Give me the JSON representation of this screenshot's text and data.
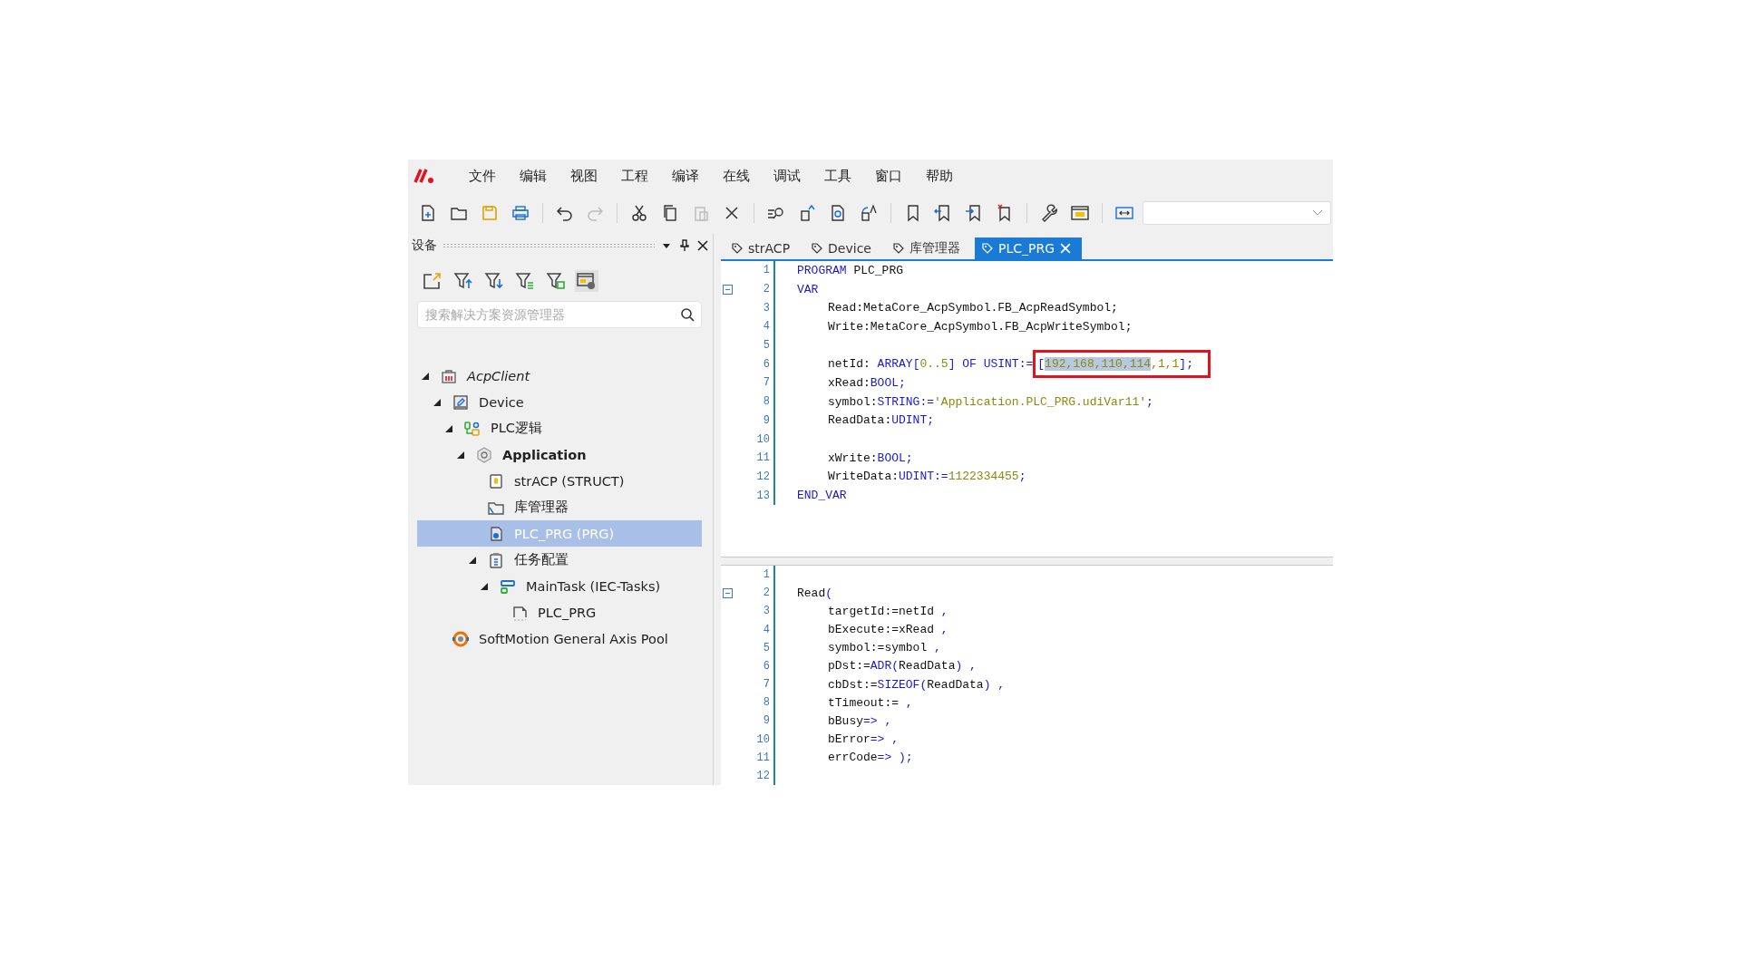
{
  "menu": [
    "文件",
    "编辑",
    "视图",
    "工程",
    "编译",
    "在线",
    "调试",
    "工具",
    "窗口",
    "帮助"
  ],
  "device_panel": {
    "title": "设备",
    "search": {
      "placeholder": "搜索解决方案资源管理器"
    },
    "tree": [
      {
        "label": "AcpClient",
        "kind": "project",
        "expanded": true,
        "selected": false,
        "children": [
          {
            "label": "Device",
            "kind": "device",
            "expanded": true,
            "selected": false,
            "children": [
              {
                "label": "PLC逻辑",
                "kind": "plc-logic",
                "expanded": true,
                "selected": false,
                "children": [
                  {
                    "label": "Application",
                    "kind": "application",
                    "expanded": true,
                    "selected": false,
                    "children": [
                      {
                        "label": "strACP (STRUCT)",
                        "kind": "struct",
                        "selected": false
                      },
                      {
                        "label": "库管理器",
                        "kind": "folder",
                        "selected": false
                      },
                      {
                        "label": "PLC_PRG (PRG)",
                        "kind": "program",
                        "selected": true
                      },
                      {
                        "label": "任务配置",
                        "kind": "task-config",
                        "expanded": true,
                        "selected": false,
                        "children": [
                          {
                            "label": "MainTask (IEC-Tasks)",
                            "kind": "task",
                            "expanded": true,
                            "selected": false,
                            "children": [
                              {
                                "label": "PLC_PRG",
                                "kind": "program-call",
                                "selected": false
                              }
                            ]
                          }
                        ]
                      }
                    ]
                  }
                ]
              }
            ]
          },
          {
            "label": "SoftMotion General Axis Pool",
            "kind": "axis-pool",
            "selected": false
          }
        ]
      }
    ]
  },
  "tabs": [
    {
      "label": "strACP",
      "selected": false
    },
    {
      "label": "Device",
      "selected": false
    },
    {
      "label": "库管理器",
      "selected": false
    },
    {
      "label": "PLC_PRG",
      "selected": true
    }
  ],
  "declaration": [
    {
      "number": "1",
      "kind": "outer",
      "fold": false,
      "segments": [
        {
          "boxed": false,
          "tokens": [
            {
              "kind": "kw",
              "text": "PROGRAM"
            },
            {
              "kind": "plain",
              "text": " PLC_PRG"
            }
          ]
        }
      ]
    },
    {
      "number": "2",
      "kind": "outer",
      "fold": true,
      "segments": [
        {
          "boxed": false,
          "tokens": [
            {
              "kind": "kw",
              "text": "VAR"
            }
          ]
        }
      ]
    },
    {
      "number": "3",
      "kind": "inner",
      "fold": false,
      "segments": [
        {
          "boxed": false,
          "tokens": [
            {
              "kind": "plain",
              "text": "Read:MetaCore_AcpSymbol.FB_AcpReadSymbol;"
            }
          ]
        }
      ]
    },
    {
      "number": "4",
      "kind": "inner",
      "fold": false,
      "segments": [
        {
          "boxed": false,
          "tokens": [
            {
              "kind": "plain",
              "text": "Write:MetaCore_AcpSymbol.FB_AcpWriteSymbol;"
            }
          ]
        }
      ]
    },
    {
      "number": "5",
      "kind": "inner",
      "fold": false
    },
    {
      "number": "6",
      "kind": "inner",
      "fold": false,
      "segments": [
        {
          "boxed": false,
          "tokens": [
            {
              "kind": "plain",
              "text": "netId: "
            },
            {
              "kind": "kw",
              "text": "ARRAY"
            },
            {
              "kind": "op",
              "text": "["
            },
            {
              "kind": "lit",
              "text": "0..5"
            },
            {
              "kind": "op",
              "text": "] "
            },
            {
              "kind": "kw",
              "text": "OF USINT"
            },
            {
              "kind": "op",
              "text": ":="
            }
          ]
        },
        {
          "boxed": true,
          "tokens": [
            {
              "kind": "op",
              "text": "[",
              "selected": false
            },
            {
              "kind": "lit",
              "text": "192,168,110,114",
              "selected": true
            },
            {
              "kind": "lit",
              "text": ",1,1",
              "selected": false
            },
            {
              "kind": "op",
              "text": "];",
              "selected": false
            }
          ]
        }
      ]
    },
    {
      "number": "7",
      "kind": "inner",
      "fold": false,
      "segments": [
        {
          "boxed": false,
          "tokens": [
            {
              "kind": "plain",
              "text": "xRead:"
            },
            {
              "kind": "kw",
              "text": "BOOL;"
            }
          ]
        }
      ]
    },
    {
      "number": "8",
      "kind": "inner",
      "fold": false,
      "segments": [
        {
          "boxed": false,
          "tokens": [
            {
              "kind": "plain",
              "text": "symbol:"
            },
            {
              "kind": "kw",
              "text": "STRING:="
            },
            {
              "kind": "lit",
              "text": "'Application.PLC_PRG.udiVar11'"
            },
            {
              "kind": "op",
              "text": ";"
            }
          ]
        }
      ]
    },
    {
      "number": "9",
      "kind": "inner",
      "fold": false,
      "segments": [
        {
          "boxed": false,
          "tokens": [
            {
              "kind": "plain",
              "text": "ReadData:"
            },
            {
              "kind": "kw",
              "text": "UDINT;"
            }
          ]
        }
      ]
    },
    {
      "number": "10",
      "kind": "inner",
      "fold": false
    },
    {
      "number": "11",
      "kind": "inner",
      "fold": false,
      "segments": [
        {
          "boxed": false,
          "tokens": [
            {
              "kind": "plain",
              "text": "xWrite:"
            },
            {
              "kind": "kw",
              "text": "BOOL;"
            }
          ]
        }
      ]
    },
    {
      "number": "12",
      "kind": "inner",
      "fold": false,
      "segments": [
        {
          "boxed": false,
          "tokens": [
            {
              "kind": "plain",
              "text": "WriteData:"
            },
            {
              "kind": "kw",
              "text": "UDINT:="
            },
            {
              "kind": "lit",
              "text": "1122334455"
            },
            {
              "kind": "op",
              "text": ";"
            }
          ]
        }
      ]
    },
    {
      "number": "13",
      "kind": "outer",
      "fold": false,
      "segments": [
        {
          "boxed": false,
          "tokens": [
            {
              "kind": "kw",
              "text": "END_VAR"
            }
          ]
        }
      ]
    }
  ],
  "implementation": [
    {
      "number": "1",
      "kind": "outer",
      "fold": false
    },
    {
      "number": "2",
      "kind": "outer",
      "fold": true,
      "segments": [
        {
          "boxed": false,
          "tokens": [
            {
              "kind": "plain",
              "text": "Read"
            },
            {
              "kind": "op",
              "text": "("
            }
          ]
        }
      ]
    },
    {
      "number": "3",
      "kind": "inner",
      "fold": false,
      "segments": [
        {
          "boxed": false,
          "tokens": [
            {
              "kind": "plain",
              "text": "targetId:=netId "
            },
            {
              "kind": "op",
              "text": ","
            }
          ]
        }
      ]
    },
    {
      "number": "4",
      "kind": "inner",
      "fold": false,
      "segments": [
        {
          "boxed": false,
          "tokens": [
            {
              "kind": "plain",
              "text": "bExecute:=xRead "
            },
            {
              "kind": "op",
              "text": ","
            }
          ]
        }
      ]
    },
    {
      "number": "5",
      "kind": "inner",
      "fold": false,
      "segments": [
        {
          "boxed": false,
          "tokens": [
            {
              "kind": "plain",
              "text": "symbol:=symbol "
            },
            {
              "kind": "op",
              "text": ","
            }
          ]
        }
      ]
    },
    {
      "number": "6",
      "kind": "inner",
      "fold": false,
      "segments": [
        {
          "boxed": false,
          "tokens": [
            {
              "kind": "plain",
              "text": "pDst:="
            },
            {
              "kind": "kw",
              "text": "ADR"
            },
            {
              "kind": "op",
              "text": "("
            },
            {
              "kind": "plain",
              "text": "ReadData"
            },
            {
              "kind": "op",
              "text": ") ,"
            }
          ]
        }
      ]
    },
    {
      "number": "7",
      "kind": "inner",
      "fold": false,
      "segments": [
        {
          "boxed": false,
          "tokens": [
            {
              "kind": "plain",
              "text": "cbDst:="
            },
            {
              "kind": "kw",
              "text": "SIZEOF"
            },
            {
              "kind": "op",
              "text": "("
            },
            {
              "kind": "plain",
              "text": "ReadData"
            },
            {
              "kind": "op",
              "text": ") ,"
            }
          ]
        }
      ]
    },
    {
      "number": "8",
      "kind": "inner",
      "fold": false,
      "segments": [
        {
          "boxed": false,
          "tokens": [
            {
              "kind": "plain",
              "text": "tTimeout:= "
            },
            {
              "kind": "op",
              "text": ","
            }
          ]
        }
      ]
    },
    {
      "number": "9",
      "kind": "inner",
      "fold": false,
      "segments": [
        {
          "boxed": false,
          "tokens": [
            {
              "kind": "plain",
              "text": "bBusy"
            },
            {
              "kind": "op",
              "text": "=> ,"
            }
          ]
        }
      ]
    },
    {
      "number": "10",
      "kind": "inner",
      "fold": false,
      "segments": [
        {
          "boxed": false,
          "tokens": [
            {
              "kind": "plain",
              "text": "bError"
            },
            {
              "kind": "op",
              "text": "=> ,"
            }
          ]
        }
      ]
    },
    {
      "number": "11",
      "kind": "inner",
      "fold": false,
      "segments": [
        {
          "boxed": false,
          "tokens": [
            {
              "kind": "plain",
              "text": "errCode"
            },
            {
              "kind": "op",
              "text": "=> );"
            }
          ]
        }
      ]
    },
    {
      "number": "12",
      "kind": "outer",
      "fold": false
    }
  ]
}
